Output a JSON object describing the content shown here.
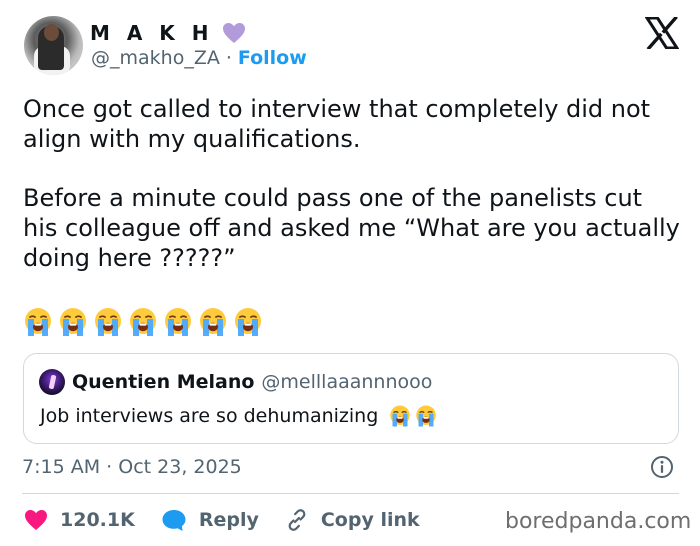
{
  "author": {
    "display_name": "M A K H",
    "handle": "@_makho_ZA",
    "separator": "·",
    "follow_label": "Follow",
    "heart_color": "#b19cd9"
  },
  "tweet": {
    "paragraphs": [
      "Once got called to interview that completely did not align with my qualifications.",
      "Before a minute could pass one of the panelists cut his colleague off and asked me “What are you actually doing here ?????”"
    ],
    "emoji_name": "loudly-crying-face",
    "emoji_count": 7
  },
  "quote": {
    "name": "Quentien Melano",
    "handle": "@melllaaannnooo",
    "text": "Job interviews are so dehumanizing",
    "emoji_count": 2
  },
  "meta": {
    "time": "7:15 AM",
    "separator": "·",
    "date": "Oct 23, 2025"
  },
  "actions": {
    "likes": "120.1K",
    "reply_label": "Reply",
    "copy_link_label": "Copy link"
  },
  "watermark": "boredpanda.com",
  "colors": {
    "link_blue": "#1d9bf0",
    "like_pink": "#f91880",
    "text_gray": "#536471"
  }
}
